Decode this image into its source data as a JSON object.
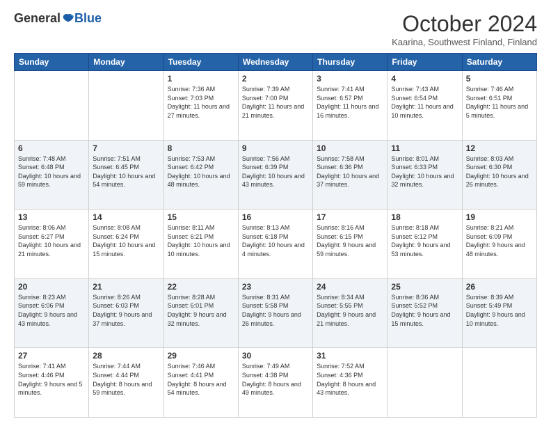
{
  "logo": {
    "general": "General",
    "blue": "Blue"
  },
  "title": "October 2024",
  "location": "Kaarina, Southwest Finland, Finland",
  "headers": [
    "Sunday",
    "Monday",
    "Tuesday",
    "Wednesday",
    "Thursday",
    "Friday",
    "Saturday"
  ],
  "weeks": [
    [
      {
        "day": "",
        "info": ""
      },
      {
        "day": "",
        "info": ""
      },
      {
        "day": "1",
        "info": "Sunrise: 7:36 AM\nSunset: 7:03 PM\nDaylight: 11 hours\nand 27 minutes."
      },
      {
        "day": "2",
        "info": "Sunrise: 7:39 AM\nSunset: 7:00 PM\nDaylight: 11 hours\nand 21 minutes."
      },
      {
        "day": "3",
        "info": "Sunrise: 7:41 AM\nSunset: 6:57 PM\nDaylight: 11 hours\nand 16 minutes."
      },
      {
        "day": "4",
        "info": "Sunrise: 7:43 AM\nSunset: 6:54 PM\nDaylight: 11 hours\nand 10 minutes."
      },
      {
        "day": "5",
        "info": "Sunrise: 7:46 AM\nSunset: 6:51 PM\nDaylight: 11 hours\nand 5 minutes."
      }
    ],
    [
      {
        "day": "6",
        "info": "Sunrise: 7:48 AM\nSunset: 6:48 PM\nDaylight: 10 hours\nand 59 minutes."
      },
      {
        "day": "7",
        "info": "Sunrise: 7:51 AM\nSunset: 6:45 PM\nDaylight: 10 hours\nand 54 minutes."
      },
      {
        "day": "8",
        "info": "Sunrise: 7:53 AM\nSunset: 6:42 PM\nDaylight: 10 hours\nand 48 minutes."
      },
      {
        "day": "9",
        "info": "Sunrise: 7:56 AM\nSunset: 6:39 PM\nDaylight: 10 hours\nand 43 minutes."
      },
      {
        "day": "10",
        "info": "Sunrise: 7:58 AM\nSunset: 6:36 PM\nDaylight: 10 hours\nand 37 minutes."
      },
      {
        "day": "11",
        "info": "Sunrise: 8:01 AM\nSunset: 6:33 PM\nDaylight: 10 hours\nand 32 minutes."
      },
      {
        "day": "12",
        "info": "Sunrise: 8:03 AM\nSunset: 6:30 PM\nDaylight: 10 hours\nand 26 minutes."
      }
    ],
    [
      {
        "day": "13",
        "info": "Sunrise: 8:06 AM\nSunset: 6:27 PM\nDaylight: 10 hours\nand 21 minutes."
      },
      {
        "day": "14",
        "info": "Sunrise: 8:08 AM\nSunset: 6:24 PM\nDaylight: 10 hours\nand 15 minutes."
      },
      {
        "day": "15",
        "info": "Sunrise: 8:11 AM\nSunset: 6:21 PM\nDaylight: 10 hours\nand 10 minutes."
      },
      {
        "day": "16",
        "info": "Sunrise: 8:13 AM\nSunset: 6:18 PM\nDaylight: 10 hours\nand 4 minutes."
      },
      {
        "day": "17",
        "info": "Sunrise: 8:16 AM\nSunset: 6:15 PM\nDaylight: 9 hours\nand 59 minutes."
      },
      {
        "day": "18",
        "info": "Sunrise: 8:18 AM\nSunset: 6:12 PM\nDaylight: 9 hours\nand 53 minutes."
      },
      {
        "day": "19",
        "info": "Sunrise: 8:21 AM\nSunset: 6:09 PM\nDaylight: 9 hours\nand 48 minutes."
      }
    ],
    [
      {
        "day": "20",
        "info": "Sunrise: 8:23 AM\nSunset: 6:06 PM\nDaylight: 9 hours\nand 43 minutes."
      },
      {
        "day": "21",
        "info": "Sunrise: 8:26 AM\nSunset: 6:03 PM\nDaylight: 9 hours\nand 37 minutes."
      },
      {
        "day": "22",
        "info": "Sunrise: 8:28 AM\nSunset: 6:01 PM\nDaylight: 9 hours\nand 32 minutes."
      },
      {
        "day": "23",
        "info": "Sunrise: 8:31 AM\nSunset: 5:58 PM\nDaylight: 9 hours\nand 26 minutes."
      },
      {
        "day": "24",
        "info": "Sunrise: 8:34 AM\nSunset: 5:55 PM\nDaylight: 9 hours\nand 21 minutes."
      },
      {
        "day": "25",
        "info": "Sunrise: 8:36 AM\nSunset: 5:52 PM\nDaylight: 9 hours\nand 15 minutes."
      },
      {
        "day": "26",
        "info": "Sunrise: 8:39 AM\nSunset: 5:49 PM\nDaylight: 9 hours\nand 10 minutes."
      }
    ],
    [
      {
        "day": "27",
        "info": "Sunrise: 7:41 AM\nSunset: 4:46 PM\nDaylight: 9 hours\nand 5 minutes."
      },
      {
        "day": "28",
        "info": "Sunrise: 7:44 AM\nSunset: 4:44 PM\nDaylight: 8 hours\nand 59 minutes."
      },
      {
        "day": "29",
        "info": "Sunrise: 7:46 AM\nSunset: 4:41 PM\nDaylight: 8 hours\nand 54 minutes."
      },
      {
        "day": "30",
        "info": "Sunrise: 7:49 AM\nSunset: 4:38 PM\nDaylight: 8 hours\nand 49 minutes."
      },
      {
        "day": "31",
        "info": "Sunrise: 7:52 AM\nSunset: 4:36 PM\nDaylight: 8 hours\nand 43 minutes."
      },
      {
        "day": "",
        "info": ""
      },
      {
        "day": "",
        "info": ""
      }
    ]
  ]
}
